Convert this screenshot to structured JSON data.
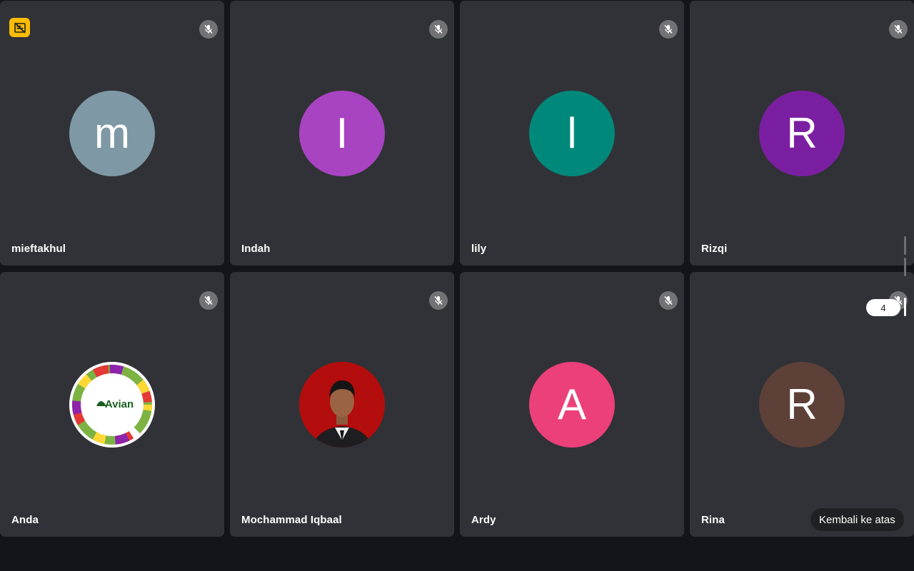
{
  "participants": [
    {
      "name": "mieftakhul",
      "initial": "m",
      "avatar_color": "#7f98a5",
      "avatar_type": "letter",
      "muted": true,
      "camera_off_badge": true
    },
    {
      "name": "Indah",
      "initial": "I",
      "avatar_color": "#a844c2",
      "avatar_type": "letter",
      "muted": true,
      "camera_off_badge": false
    },
    {
      "name": "lily",
      "initial": "l",
      "avatar_color": "#00897b",
      "avatar_type": "letter",
      "muted": true,
      "camera_off_badge": false
    },
    {
      "name": "Rizqi",
      "initial": "R",
      "avatar_color": "#7b1fa2",
      "avatar_type": "letter",
      "muted": true,
      "camera_off_badge": false
    },
    {
      "name": "Anda",
      "initial": "",
      "avatar_color": "#ffffff",
      "avatar_type": "logo",
      "logo_text": "Avian",
      "muted": true,
      "camera_off_badge": false
    },
    {
      "name": "Mochammad Iqbaal",
      "initial": "",
      "avatar_color": "#b30d0d",
      "avatar_type": "photo",
      "muted": true,
      "camera_off_badge": false
    },
    {
      "name": "Ardy",
      "initial": "A",
      "avatar_color": "#ec407a",
      "avatar_type": "letter",
      "muted": true,
      "camera_off_badge": false
    },
    {
      "name": "Rina",
      "initial": "R",
      "avatar_color": "#5d4037",
      "avatar_type": "letter",
      "muted": true,
      "camera_off_badge": false
    }
  ],
  "page_indicator": "4",
  "back_to_top_label": "Kembali ke atas",
  "colors": {
    "background": "#13151b",
    "tile": "#313237",
    "camera_off_badge": "#fbbc04"
  }
}
